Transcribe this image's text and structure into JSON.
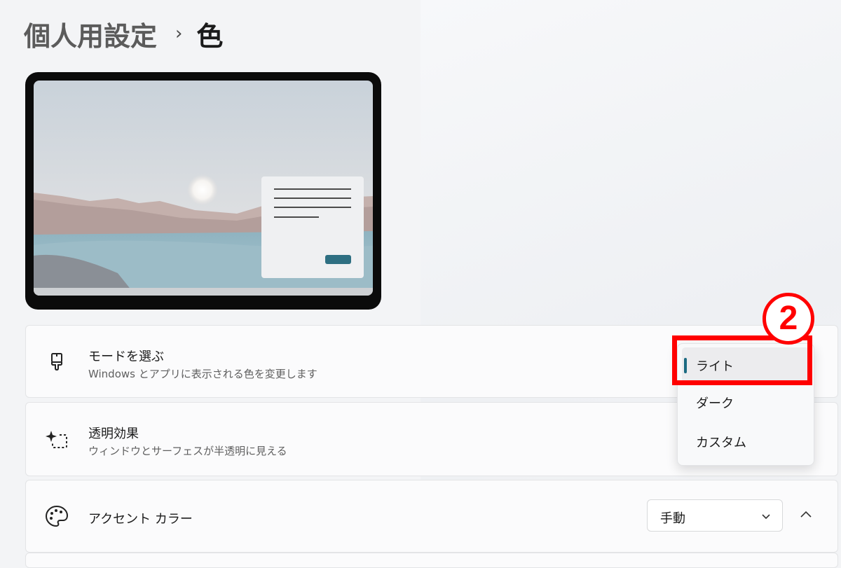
{
  "breadcrumb": {
    "parent": "個人用設定",
    "separator": "›",
    "current": "色"
  },
  "preview": {
    "dialog_button_color": "#2e6f82"
  },
  "settings": {
    "mode": {
      "title": "モードを選ぶ",
      "subtitle": "Windows とアプリに表示される色を変更します",
      "icon": "paintbrush-icon"
    },
    "transparency": {
      "title": "透明効果",
      "subtitle": "ウィンドウとサーフェスが半透明に見える",
      "icon": "transparency-sparkle-icon"
    },
    "accent": {
      "title": "アクセント カラー",
      "icon": "palette-icon",
      "dropdown_value": "手動"
    }
  },
  "mode_menu": {
    "options": [
      "ライト",
      "ダーク",
      "カスタム"
    ],
    "selected": "ライト"
  },
  "annotation": {
    "step_number": "2",
    "color": "#ff0000"
  },
  "colors": {
    "accent": "#1c6b82",
    "toggle_on": "#2b6f86"
  }
}
